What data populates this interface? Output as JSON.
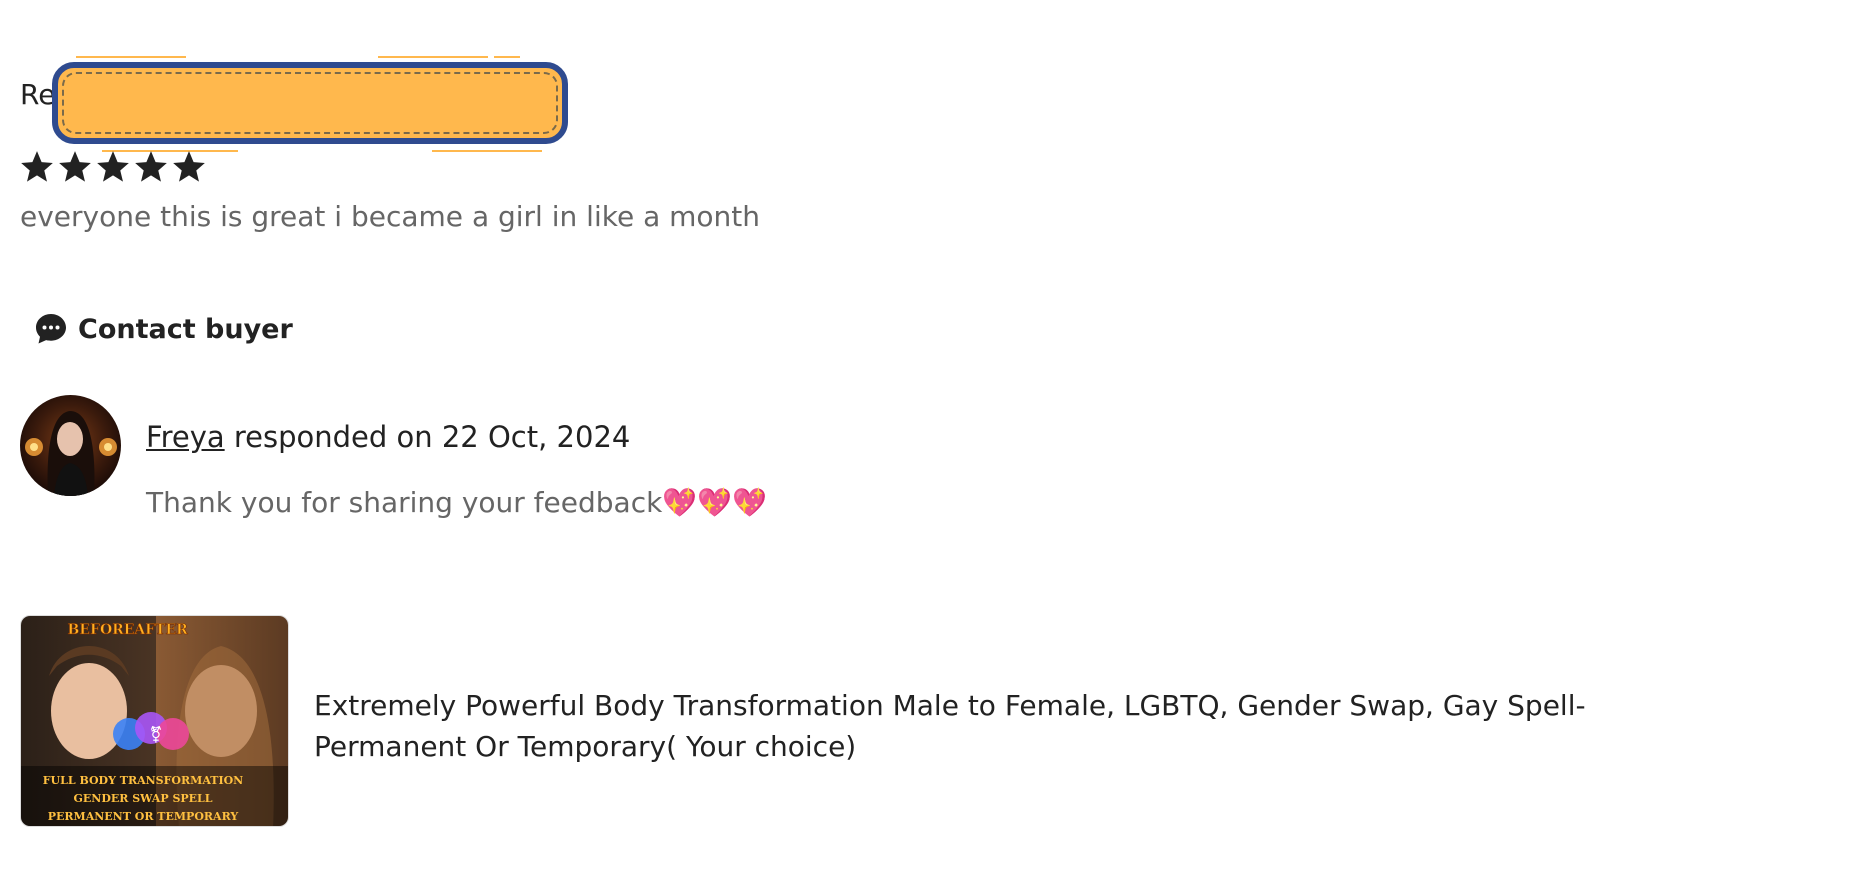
{
  "review": {
    "label": "Re",
    "rating": 5,
    "text": "everyone this is great i became a girl in like a month"
  },
  "contact": {
    "label": "Contact buyer",
    "icon": "chat-bubble-icon"
  },
  "response": {
    "seller_name": "Freya",
    "responded_text": " responded on 22 Oct, 2024",
    "message": "Thank you for sharing your feedback💖💖💖"
  },
  "product": {
    "title": "Extremely Powerful Body Transformation Male to Female, LGBTQ, Gender Swap, Gay Spell- Permanent Or Temporary( Your choice)",
    "thumb_text": {
      "before_after": "BEFORE AFTER",
      "caption_line1": "FULL BODY TRANSFORMATION",
      "caption_line2": "GENDER SWAP SPELL",
      "caption_line3": "PERMANENT OR TEMPORARY"
    }
  },
  "colors": {
    "redaction_fill": "#ffb84d",
    "redaction_border": "#2f4b8f",
    "muted_text": "#666666",
    "primary_text": "#222222"
  }
}
